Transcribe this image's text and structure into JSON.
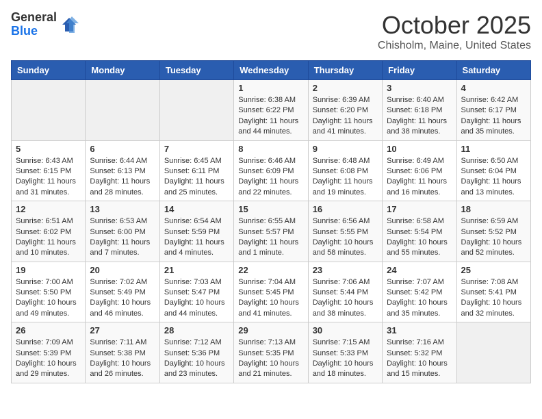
{
  "logo": {
    "general": "General",
    "blue": "Blue"
  },
  "title": "October 2025",
  "location": "Chisholm, Maine, United States",
  "days_of_week": [
    "Sunday",
    "Monday",
    "Tuesday",
    "Wednesday",
    "Thursday",
    "Friday",
    "Saturday"
  ],
  "weeks": [
    [
      {
        "day": "",
        "content": ""
      },
      {
        "day": "",
        "content": ""
      },
      {
        "day": "",
        "content": ""
      },
      {
        "day": "1",
        "content": "Sunrise: 6:38 AM\nSunset: 6:22 PM\nDaylight: 11 hours and 44 minutes."
      },
      {
        "day": "2",
        "content": "Sunrise: 6:39 AM\nSunset: 6:20 PM\nDaylight: 11 hours and 41 minutes."
      },
      {
        "day": "3",
        "content": "Sunrise: 6:40 AM\nSunset: 6:18 PM\nDaylight: 11 hours and 38 minutes."
      },
      {
        "day": "4",
        "content": "Sunrise: 6:42 AM\nSunset: 6:17 PM\nDaylight: 11 hours and 35 minutes."
      }
    ],
    [
      {
        "day": "5",
        "content": "Sunrise: 6:43 AM\nSunset: 6:15 PM\nDaylight: 11 hours and 31 minutes."
      },
      {
        "day": "6",
        "content": "Sunrise: 6:44 AM\nSunset: 6:13 PM\nDaylight: 11 hours and 28 minutes."
      },
      {
        "day": "7",
        "content": "Sunrise: 6:45 AM\nSunset: 6:11 PM\nDaylight: 11 hours and 25 minutes."
      },
      {
        "day": "8",
        "content": "Sunrise: 6:46 AM\nSunset: 6:09 PM\nDaylight: 11 hours and 22 minutes."
      },
      {
        "day": "9",
        "content": "Sunrise: 6:48 AM\nSunset: 6:08 PM\nDaylight: 11 hours and 19 minutes."
      },
      {
        "day": "10",
        "content": "Sunrise: 6:49 AM\nSunset: 6:06 PM\nDaylight: 11 hours and 16 minutes."
      },
      {
        "day": "11",
        "content": "Sunrise: 6:50 AM\nSunset: 6:04 PM\nDaylight: 11 hours and 13 minutes."
      }
    ],
    [
      {
        "day": "12",
        "content": "Sunrise: 6:51 AM\nSunset: 6:02 PM\nDaylight: 11 hours and 10 minutes."
      },
      {
        "day": "13",
        "content": "Sunrise: 6:53 AM\nSunset: 6:00 PM\nDaylight: 11 hours and 7 minutes."
      },
      {
        "day": "14",
        "content": "Sunrise: 6:54 AM\nSunset: 5:59 PM\nDaylight: 11 hours and 4 minutes."
      },
      {
        "day": "15",
        "content": "Sunrise: 6:55 AM\nSunset: 5:57 PM\nDaylight: 11 hours and 1 minute."
      },
      {
        "day": "16",
        "content": "Sunrise: 6:56 AM\nSunset: 5:55 PM\nDaylight: 10 hours and 58 minutes."
      },
      {
        "day": "17",
        "content": "Sunrise: 6:58 AM\nSunset: 5:54 PM\nDaylight: 10 hours and 55 minutes."
      },
      {
        "day": "18",
        "content": "Sunrise: 6:59 AM\nSunset: 5:52 PM\nDaylight: 10 hours and 52 minutes."
      }
    ],
    [
      {
        "day": "19",
        "content": "Sunrise: 7:00 AM\nSunset: 5:50 PM\nDaylight: 10 hours and 49 minutes."
      },
      {
        "day": "20",
        "content": "Sunrise: 7:02 AM\nSunset: 5:49 PM\nDaylight: 10 hours and 46 minutes."
      },
      {
        "day": "21",
        "content": "Sunrise: 7:03 AM\nSunset: 5:47 PM\nDaylight: 10 hours and 44 minutes."
      },
      {
        "day": "22",
        "content": "Sunrise: 7:04 AM\nSunset: 5:45 PM\nDaylight: 10 hours and 41 minutes."
      },
      {
        "day": "23",
        "content": "Sunrise: 7:06 AM\nSunset: 5:44 PM\nDaylight: 10 hours and 38 minutes."
      },
      {
        "day": "24",
        "content": "Sunrise: 7:07 AM\nSunset: 5:42 PM\nDaylight: 10 hours and 35 minutes."
      },
      {
        "day": "25",
        "content": "Sunrise: 7:08 AM\nSunset: 5:41 PM\nDaylight: 10 hours and 32 minutes."
      }
    ],
    [
      {
        "day": "26",
        "content": "Sunrise: 7:09 AM\nSunset: 5:39 PM\nDaylight: 10 hours and 29 minutes."
      },
      {
        "day": "27",
        "content": "Sunrise: 7:11 AM\nSunset: 5:38 PM\nDaylight: 10 hours and 26 minutes."
      },
      {
        "day": "28",
        "content": "Sunrise: 7:12 AM\nSunset: 5:36 PM\nDaylight: 10 hours and 23 minutes."
      },
      {
        "day": "29",
        "content": "Sunrise: 7:13 AM\nSunset: 5:35 PM\nDaylight: 10 hours and 21 minutes."
      },
      {
        "day": "30",
        "content": "Sunrise: 7:15 AM\nSunset: 5:33 PM\nDaylight: 10 hours and 18 minutes."
      },
      {
        "day": "31",
        "content": "Sunrise: 7:16 AM\nSunset: 5:32 PM\nDaylight: 10 hours and 15 minutes."
      },
      {
        "day": "",
        "content": ""
      }
    ]
  ]
}
